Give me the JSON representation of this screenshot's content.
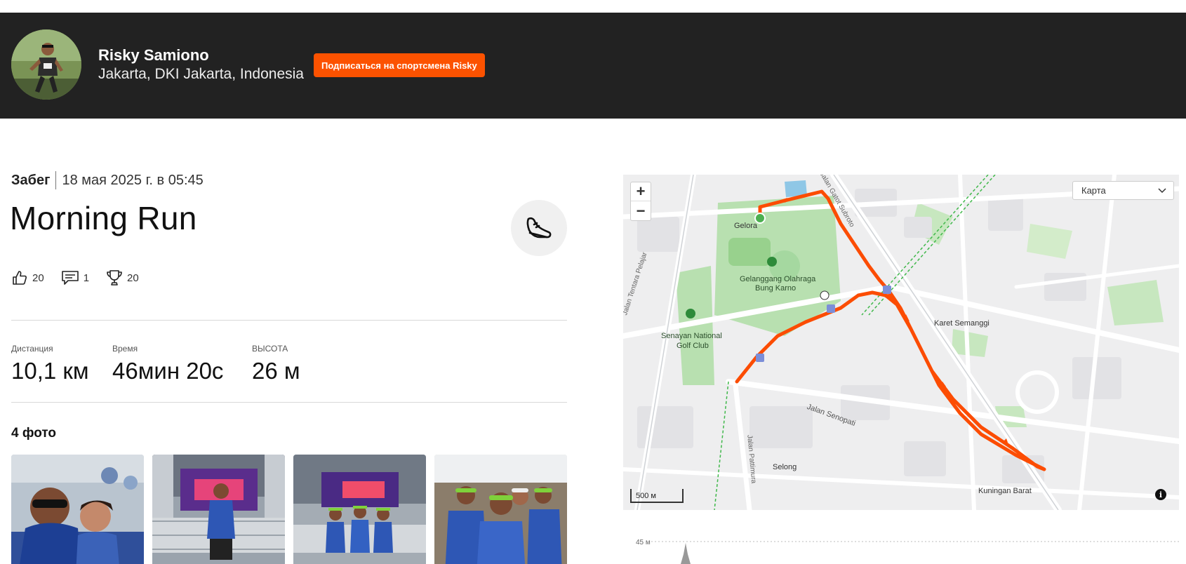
{
  "header": {
    "athlete_name": "Risky Samiono",
    "athlete_location": "Jakarta, DKI Jakarta, Indonesia",
    "follow_label": "Подписаться на спортсмена Risky",
    "accent_color": "#fc5200",
    "background_color": "#222222"
  },
  "activity": {
    "type": "Забег",
    "datetime": "18 мая 2025 г. в 05:45",
    "title": "Morning Run",
    "sport_icon": "running-shoe-icon"
  },
  "social": {
    "kudos_count": "20",
    "comments_count": "1",
    "achievements_count": "20"
  },
  "stats": [
    {
      "label": "Дистанция",
      "value": "10,1 км"
    },
    {
      "label": "Время",
      "value": "46мин 20с"
    },
    {
      "label": "ВЫСОТА",
      "value": "26 м"
    }
  ],
  "photos": {
    "title": "4 фото",
    "count": 4
  },
  "map": {
    "zoom_in": "+",
    "zoom_out": "−",
    "layer_select": "Карта",
    "scale_label": "500 м",
    "info": "i",
    "route_color": "#fc4c02",
    "labels": [
      "Gelora",
      "Gelanggang Olahraga",
      "Bung Karno",
      "Senayan National",
      "Golf Club",
      "Karet Semanggi",
      "Jalan Senopati",
      "Selong",
      "Kuningan Barat",
      "Jalan Tentara Pelajar",
      "Jalan Pattimura",
      "Jalan Gatot Subroto"
    ]
  },
  "elevation": {
    "axis_label": "45 м"
  }
}
